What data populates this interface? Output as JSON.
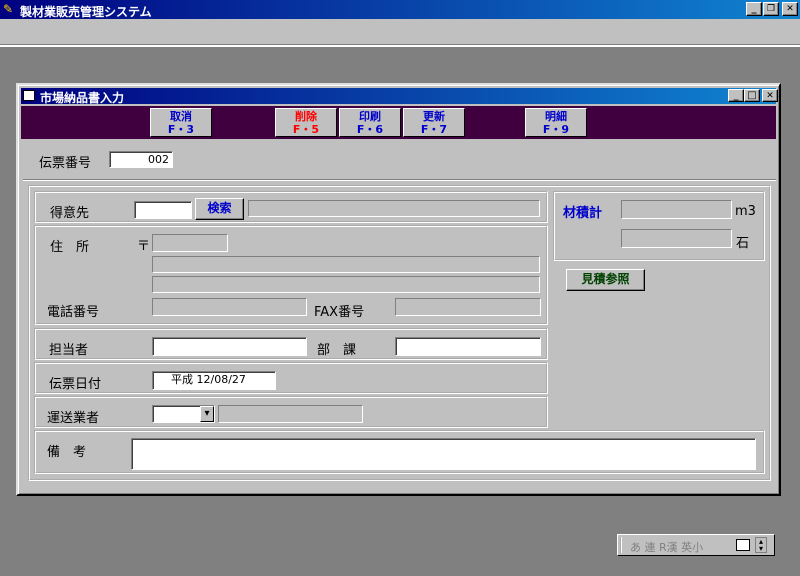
{
  "app": {
    "title": "製材業販売管理システム",
    "controls": {
      "minimize": "_",
      "restore": "❐",
      "close": "✕"
    }
  },
  "window": {
    "title": "市場納品書入力",
    "controls": {
      "minimize": "_",
      "maximize": "□",
      "close": "✕"
    }
  },
  "fkeys": [
    {
      "label": "取消",
      "key": "F・3"
    },
    {
      "label": "削除",
      "key": "F・5"
    },
    {
      "label": "印刷",
      "key": "F・6"
    },
    {
      "label": "更新",
      "key": "F・7"
    },
    {
      "label": "明細",
      "key": "F・9"
    }
  ],
  "slip": {
    "label": "伝票番号",
    "value": "002"
  },
  "customer": {
    "label": "得意先",
    "search_label": "検索"
  },
  "address": {
    "label": "住　所",
    "postal_mark": "〒"
  },
  "phone": {
    "label": "電話番号",
    "fax_label": "FAX番号"
  },
  "staff": {
    "label": "担当者",
    "dept_label": "部　課"
  },
  "date": {
    "label": "伝票日付",
    "value": "平成 12/08/27"
  },
  "carrier": {
    "label": "運送業者",
    "dropdown": "▾"
  },
  "notes": {
    "label": "備　考"
  },
  "volume": {
    "label": "材積計",
    "unit1": "m3",
    "unit2": "石"
  },
  "estimate_button": "見積参照",
  "ime": {
    "text": "あ 連 R漢 英小"
  }
}
